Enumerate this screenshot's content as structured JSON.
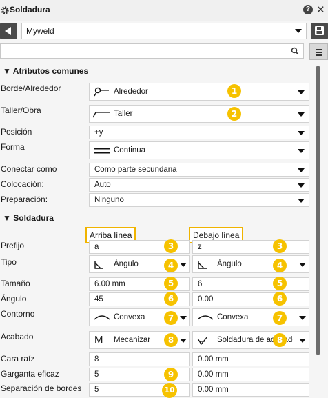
{
  "window": {
    "title": "Soldadura",
    "help_label": "?",
    "close_label": "✕"
  },
  "preset": {
    "value": "Myweld"
  },
  "search": {
    "value": "",
    "placeholder": ""
  },
  "common": {
    "section_title": "Atributos comunes",
    "fields": [
      {
        "label": "Borde/Alrededor",
        "value": "Alrededor",
        "icon": "weld-around-icon",
        "badge": "1"
      },
      {
        "label": "Taller/Obra",
        "value": "Taller",
        "icon": "shop-weld-icon",
        "badge": "2"
      },
      {
        "label": "Posición",
        "value": "+y"
      },
      {
        "label": "Forma",
        "value": "Continua",
        "icon": "continuous-weld-icon"
      },
      {
        "label": "Conectar como",
        "value": "Como parte secundaria"
      },
      {
        "label": "Colocación:",
        "value": "Auto"
      },
      {
        "label": "Preparación:",
        "value": "Ninguno"
      }
    ]
  },
  "weld": {
    "section_title": "Soldadura",
    "above_header": "Arriba línea",
    "below_header": "Debajo línea",
    "rows": [
      {
        "label": "Prefijo",
        "above": "a",
        "below": "z",
        "badge": "3"
      },
      {
        "label": "Tipo",
        "above": "Ángulo",
        "below": "Ángulo",
        "badge": "4"
      },
      {
        "label": "Tamaño",
        "above": "6.00 mm",
        "below": "6",
        "badge": "5"
      },
      {
        "label": "Ángulo",
        "above": "45",
        "below": "0.00",
        "badge": "6"
      },
      {
        "label": "Contorno",
        "above": "Convexa",
        "below": "Convexa",
        "badge": "7"
      },
      {
        "label": "Acabado",
        "above": "Mecanizar",
        "below": "Soldadura de acabado",
        "badge": "8",
        "above_icon_text": "M"
      },
      {
        "label": "Cara raíz",
        "above": "8",
        "below": "0.00 mm"
      },
      {
        "label": "Garganta eficaz",
        "above": "5",
        "below": "0.00 mm",
        "badge": "9"
      },
      {
        "label": "Separación de bordes",
        "above": "5",
        "below": "0.00 mm",
        "badge": "10"
      }
    ]
  },
  "colors": {
    "badge": "#f6c200",
    "highlight": "#f0b400",
    "dark_button": "#4a4a4a"
  }
}
